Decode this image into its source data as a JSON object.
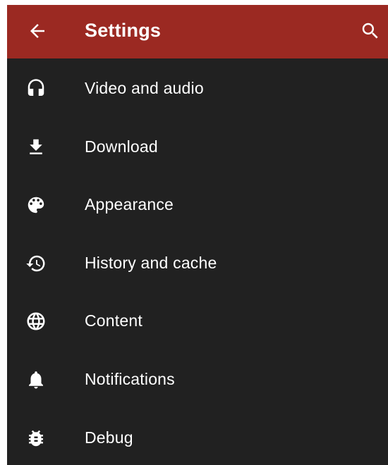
{
  "appbar": {
    "title": "Settings",
    "back_icon": "arrow-back-icon",
    "search_icon": "search-icon",
    "color": "#9b2922"
  },
  "settings": {
    "items": [
      {
        "label": "Video and audio",
        "icon": "headphones-icon"
      },
      {
        "label": "Download",
        "icon": "download-icon"
      },
      {
        "label": "Appearance",
        "icon": "palette-icon"
      },
      {
        "label": "History and cache",
        "icon": "history-icon"
      },
      {
        "label": "Content",
        "icon": "globe-icon"
      },
      {
        "label": "Notifications",
        "icon": "bell-icon"
      },
      {
        "label": "Debug",
        "icon": "bug-icon"
      }
    ]
  },
  "colors": {
    "background": "#212121",
    "text": "#ffffff",
    "accent": "#9b2922"
  }
}
